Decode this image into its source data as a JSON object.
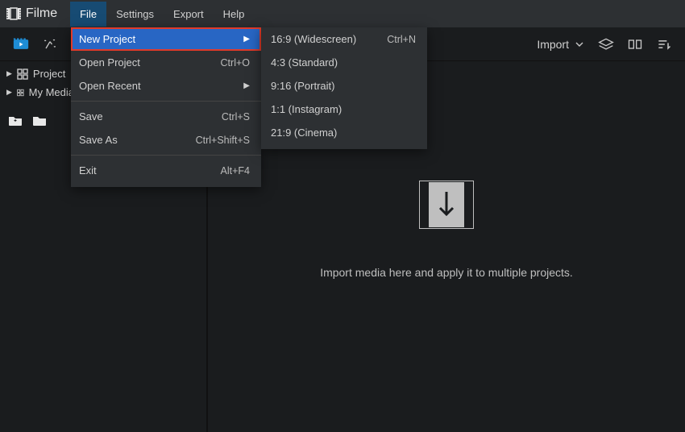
{
  "app": {
    "name": "Filme"
  },
  "menubar": {
    "items": [
      "File",
      "Settings",
      "Export",
      "Help"
    ],
    "activeIndex": 0
  },
  "toolbar": {
    "import_label": "Import"
  },
  "sidebar": {
    "items": [
      {
        "label": "Project"
      },
      {
        "label": "My Media"
      }
    ]
  },
  "dropdown": {
    "items": [
      {
        "label": "New Project",
        "hasSubmenu": true,
        "highlighted": true
      },
      {
        "label": "Open Project",
        "shortcut": "Ctrl+O"
      },
      {
        "label": "Open Recent",
        "hasSubmenu": true
      },
      {
        "label": "Save",
        "shortcut": "Ctrl+S"
      },
      {
        "label": "Save As",
        "shortcut": "Ctrl+Shift+S"
      },
      {
        "label": "Exit",
        "shortcut": "Alt+F4"
      }
    ]
  },
  "submenu": {
    "items": [
      {
        "label": "16:9 (Widescreen)",
        "shortcut": "Ctrl+N"
      },
      {
        "label": "4:3 (Standard)"
      },
      {
        "label": "9:16 (Portrait)"
      },
      {
        "label": "1:1 (Instagram)"
      },
      {
        "label": "21:9 (Cinema)"
      }
    ]
  },
  "main": {
    "drop_text": "Import media here and apply it to multiple projects."
  }
}
